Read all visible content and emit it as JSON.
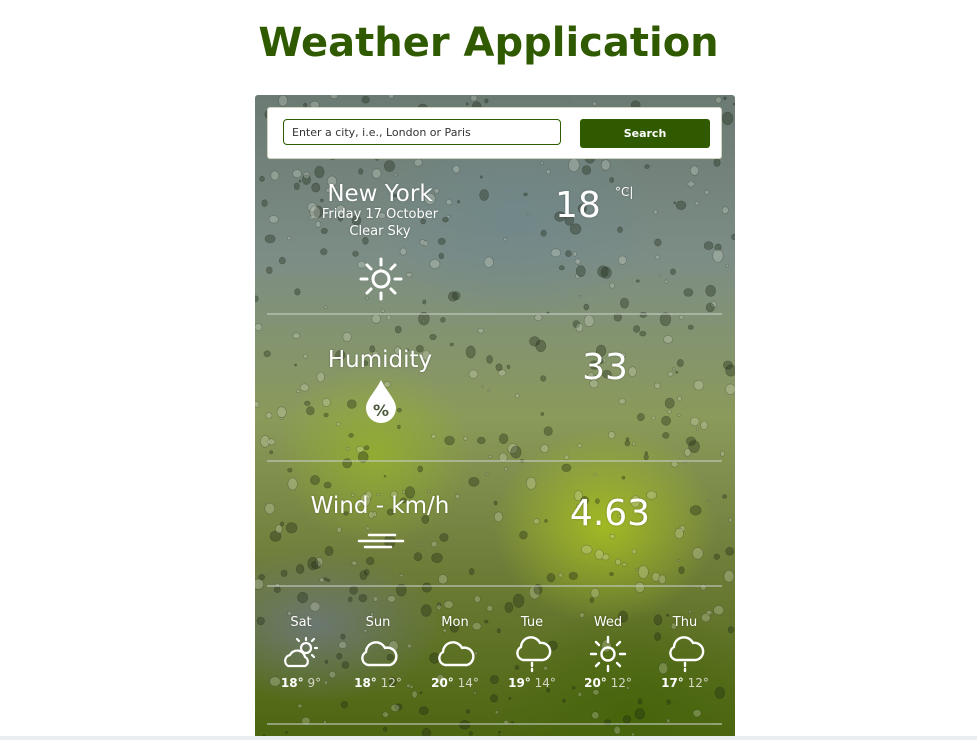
{
  "app_title": "Weather Application",
  "search": {
    "placeholder": "Enter a city, i.e., London or Paris",
    "button_label": "Search"
  },
  "current": {
    "city": "New York",
    "date": "Friday 17 October",
    "condition": "Clear Sky",
    "condition_icon": "sun-icon",
    "temperature": "18",
    "unit": "°C|"
  },
  "humidity": {
    "label": "Humidity",
    "value": "33",
    "icon": "humidity-drop-icon"
  },
  "wind": {
    "label": "Wind - km/h",
    "value": "4.63",
    "icon": "wind-icon"
  },
  "forecast": [
    {
      "day": "Sat",
      "max": "18°",
      "min": "9°",
      "icon": "partly-sunny-icon"
    },
    {
      "day": "Sun",
      "max": "18°",
      "min": "12°",
      "icon": "cloud-icon"
    },
    {
      "day": "Mon",
      "max": "20°",
      "min": "14°",
      "icon": "cloud-icon"
    },
    {
      "day": "Tue",
      "max": "19°",
      "min": "14°",
      "icon": "cloud-drizzle-icon"
    },
    {
      "day": "Wed",
      "max": "20°",
      "min": "12°",
      "icon": "sun-icon"
    },
    {
      "day": "Thu",
      "max": "17°",
      "min": "12°",
      "icon": "cloud-drizzle-icon"
    }
  ],
  "colors": {
    "brand_green": "#2f5a00",
    "text_white": "#ffffff"
  }
}
